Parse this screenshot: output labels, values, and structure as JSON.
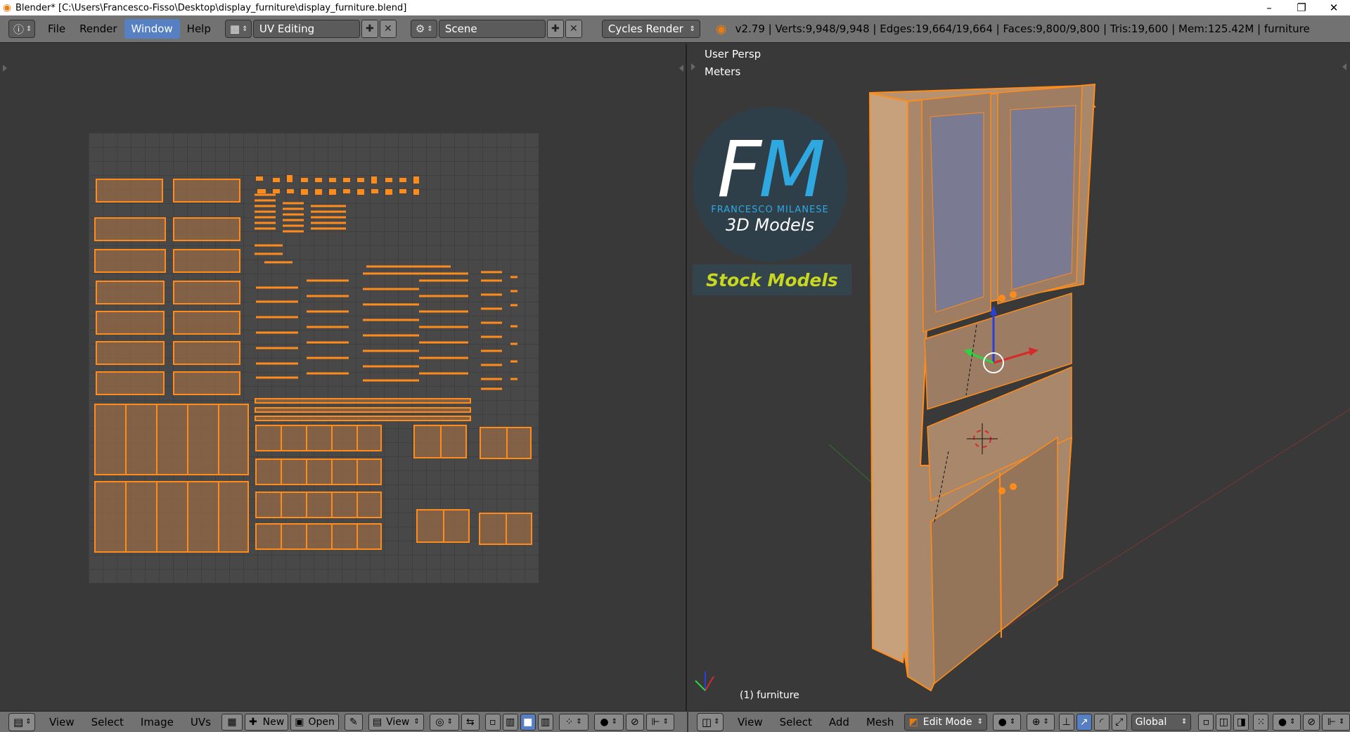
{
  "titlebar": {
    "title": "Blender* [C:\\Users\\Francesco-Fisso\\Desktop\\display_furniture\\display_furniture.blend]",
    "minimize": "–",
    "restore": "❐",
    "close": "✕"
  },
  "topbar": {
    "menus": [
      "File",
      "Render",
      "Window",
      "Help"
    ],
    "active_menu": "Window",
    "layout": "UV Editing",
    "scene": "Scene",
    "engine": "Cycles Render",
    "stats": "v2.79 | Verts:9,948/9,948 | Edges:19,664/19,664 | Faces:9,800/9,800 | Tris:19,600 | Mem:125.42M | furniture"
  },
  "uv_editor": {
    "menus": [
      "View",
      "Select",
      "Image",
      "UVs"
    ],
    "new_label": "New",
    "open_label": "Open",
    "view_label": "View"
  },
  "viewport": {
    "view_name": "User Persp",
    "units": "Meters",
    "object_label": "(1) furniture",
    "menus": [
      "View",
      "Select",
      "Add",
      "Mesh"
    ],
    "mode": "Edit Mode",
    "orientation": "Global"
  },
  "watermark": {
    "f": "F",
    "m": "M",
    "name": "FRANCESCO MILANESE",
    "models": "3D Models",
    "stock": "Stock Models"
  },
  "colors": {
    "accent": "#ff8c1a",
    "header": "#727272",
    "active": "#5680c2",
    "background": "#393939"
  }
}
